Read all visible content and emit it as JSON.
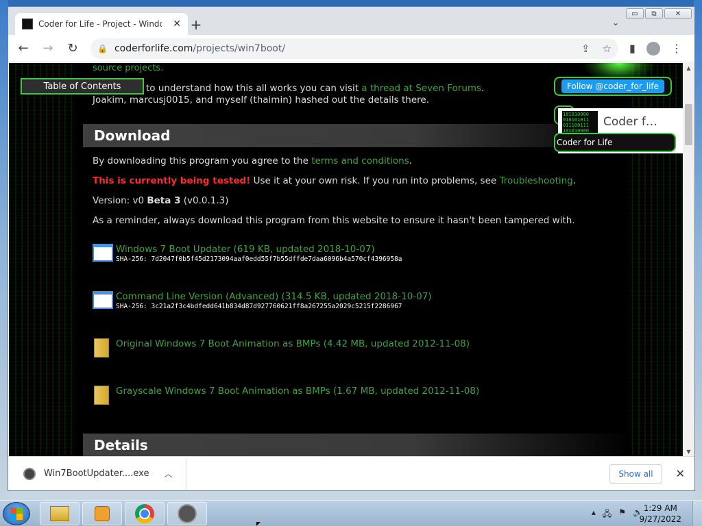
{
  "browser": {
    "tab_title": "Coder for Life - Project - Window",
    "new_tab": "+",
    "tab_close": "✕",
    "tab_search": "⌄",
    "window_buttons": [
      "▭",
      "⧉",
      "✕"
    ],
    "url_host": "coderforlife.com",
    "url_path": "/projects/win7boot/"
  },
  "page": {
    "toc_label": "Table of Contents",
    "top_line1": "source projects.",
    "top_line2_prefix": "to understand how this all works you can visit ",
    "top_line2_link": "a thread at Seven Forums",
    "top_line2_suffix": ".",
    "top_line3": "Joakim, marcusj0015, and myself (thaimin) hashed out the details there.",
    "download_heading": "Download",
    "terms_prefix": "By downloading this program you agree to the ",
    "terms_link": "terms and conditions",
    "terms_suffix": ".",
    "warn_text": "This is currently being tested!",
    "warn_rest": " Use it at your own risk. If you run into problems, see ",
    "troubleshooting_link": "Troubleshooting",
    "warn_suffix": ".",
    "version_prefix": "Version: v0 ",
    "version_beta": "Beta 3",
    "version_suffix": " (v0.0.1.3)",
    "reminder": "As a reminder, always download this program from this website to ensure it hasn't been tampered with.",
    "downloads": [
      {
        "title": "Windows 7 Boot Updater (619 KB, updated 2018-10-07)",
        "hash": "SHA-256: 7d2047f0b5f45d2173094aaf0edd55f7b55dffde7daa6096b4a570cf4396958a"
      },
      {
        "title": "Command Line Version (Advanced) (314.5 KB, updated 2018-10-07)",
        "hash": "SHA-256: 3c21a2f3c4bdfedd641b834d87d927760621ff8a267255a2029c5215f2286967"
      },
      {
        "title": "Original Windows 7 Boot Animation as BMPs (4.42 MB, updated 2012-11-08)"
      },
      {
        "title": "Grayscale Windows 7 Boot Animation as BMPs (1.67 MB, updated 2012-11-08)"
      }
    ],
    "details_heading": "Details",
    "follow_label": "Follow @coder_for_life",
    "card_title": "Coder f…",
    "card_label": "Coder for Life"
  },
  "downloads_bar": {
    "file": "Win7BootUpdater....exe",
    "show_all": "Show all"
  },
  "taskbar": {
    "time": "1:29 AM",
    "date": "9/27/2022"
  }
}
